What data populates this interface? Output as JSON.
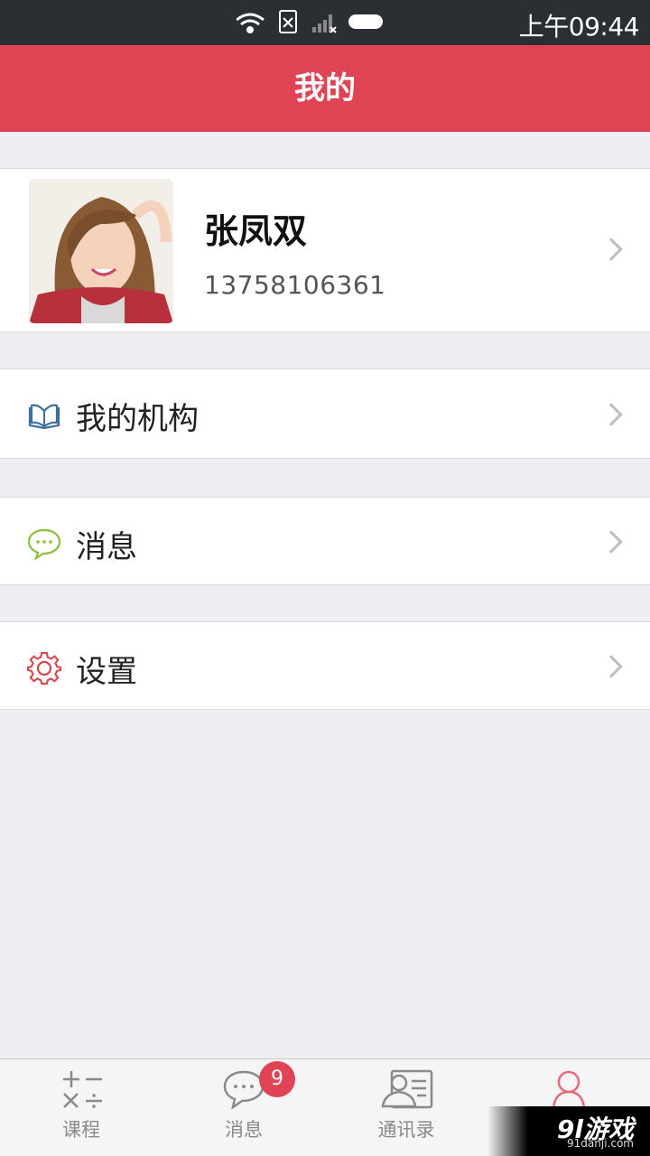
{
  "status_bar": {
    "time": "上午09:44"
  },
  "app_bar": {
    "title": "我的"
  },
  "profile": {
    "name": "张凤双",
    "phone": "13758106361"
  },
  "menu": [
    {
      "label": "我的机构",
      "icon": "book-icon",
      "color": "#3d6e9e"
    },
    {
      "label": "消息",
      "icon": "chat-icon",
      "color": "#8bbf3a"
    },
    {
      "label": "设置",
      "icon": "gear-icon",
      "color": "#d84650"
    }
  ],
  "tabs": [
    {
      "label": "课程",
      "icon": "math-operators-icon"
    },
    {
      "label": "消息",
      "icon": "chat-bubble-icon",
      "badge": "9"
    },
    {
      "label": "通讯录",
      "icon": "contacts-icon"
    },
    {
      "label": "",
      "icon": "person-icon",
      "active_color": "#e86a7a"
    }
  ],
  "watermark": {
    "logo": "9l游戏",
    "url": "91danji.com"
  }
}
